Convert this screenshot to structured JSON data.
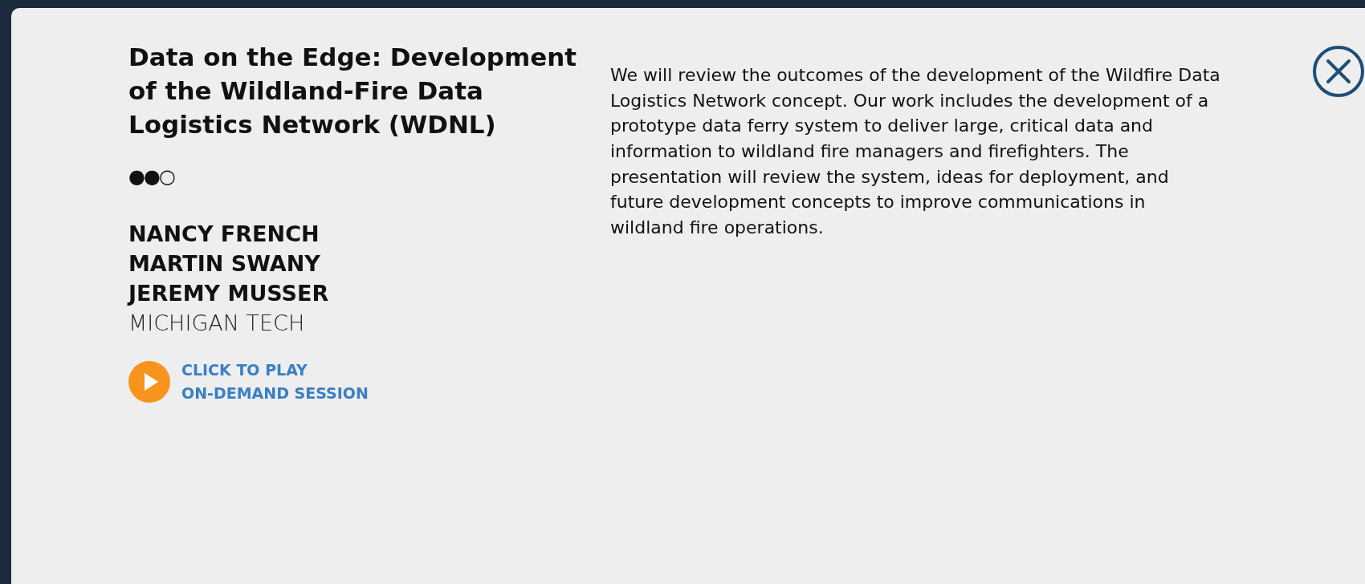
{
  "session": {
    "title": "Data on the Edge: Development of the Wildland-Fire Data Logistics Network (WDNL)",
    "level_indicator": "●●○",
    "speakers": [
      {
        "name": "NANCY FRENCH"
      },
      {
        "name": "MARTIN SWANY"
      },
      {
        "name": "JEREMY MUSSER"
      }
    ],
    "organization": "MICHIGAN TECH",
    "play_link": [
      "CLICK TO PLAY",
      "ON-DEMAND SESSION"
    ],
    "description": "We will review the outcomes of the development of the Wildfire Data Logistics Network concept. Our work includes the development of a prototype data ferry system to deliver large, critical data and information to wildland fire managers and firefighters. The presentation will review the system, ideas for deployment, and future development concepts to improve communications in wildland fire operations."
  }
}
